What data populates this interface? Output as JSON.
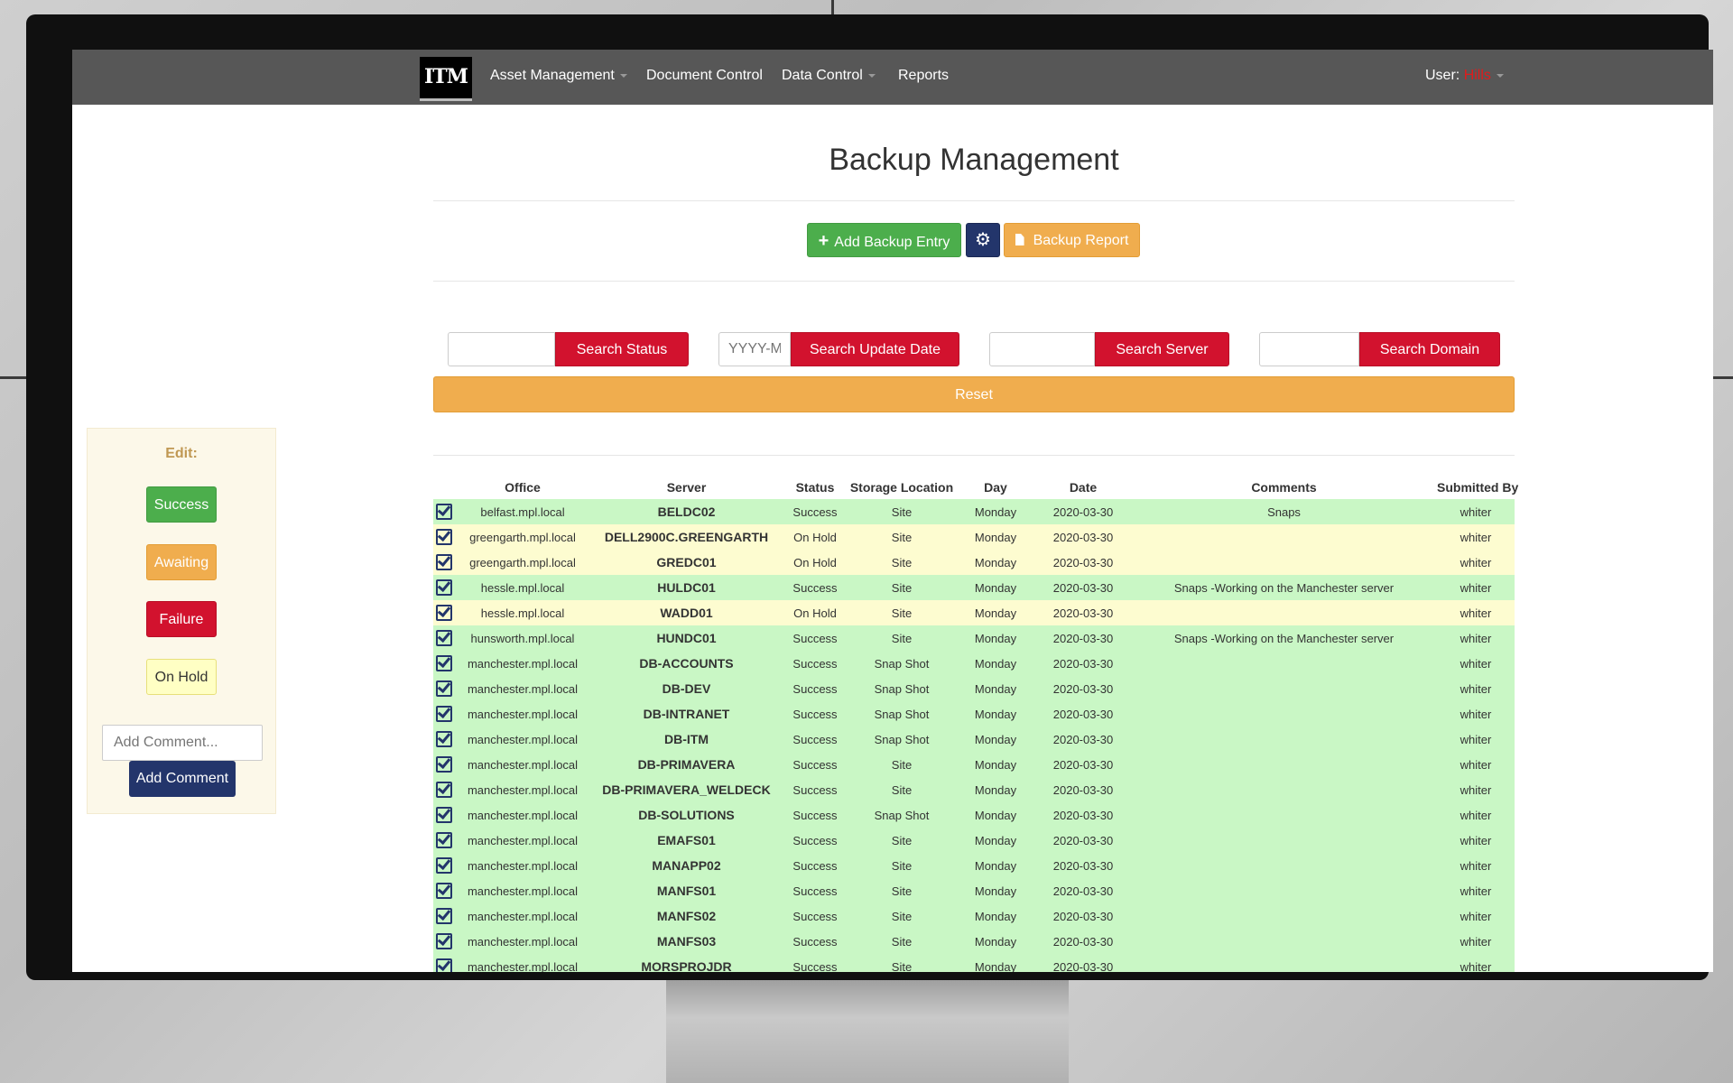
{
  "nav": {
    "brand": "ITM",
    "items": [
      "Asset Management",
      "Document Control",
      "Data Control",
      "Reports"
    ],
    "user_label": "User:",
    "user_name": "Hills"
  },
  "page": {
    "title": "Backup Management",
    "add_button": "Add Backup Entry",
    "report_button": "Backup Report"
  },
  "search": {
    "status_button": "Search Status",
    "date_placeholder": "YYYY-M",
    "date_button": "Search Update Date",
    "server_button": "Search Server",
    "domain_button": "Search Domain",
    "reset_button": "Reset"
  },
  "edit_panel": {
    "title": "Edit:",
    "success": "Success",
    "awaiting": "Awaiting",
    "failure": "Failure",
    "on_hold": "On Hold",
    "comment_placeholder": "Add Comment...",
    "comment_button": "Add Comment"
  },
  "colors": {
    "navbar": "#575757",
    "success_row": "#c9f7c5",
    "hold_row": "#fdfcd0",
    "primary": "#23356b",
    "danger": "#d2122e",
    "warning": "#f0ad4e",
    "success": "#4cae4c"
  },
  "table": {
    "headers": [
      "",
      "Office",
      "Server",
      "Status",
      "Storage Location",
      "Day",
      "Date",
      "Comments",
      "Submitted By"
    ],
    "rows": [
      {
        "office": "belfast.mpl.local",
        "server": "BELDC02",
        "status": "Success",
        "storage": "Site",
        "day": "Monday",
        "date": "2020-03-30",
        "comments": "Snaps",
        "by": "whiter"
      },
      {
        "office": "greengarth.mpl.local",
        "server": "DELL2900C.GREENGARTH",
        "status": "On Hold",
        "storage": "Site",
        "day": "Monday",
        "date": "2020-03-30",
        "comments": "",
        "by": "whiter"
      },
      {
        "office": "greengarth.mpl.local",
        "server": "GREDC01",
        "status": "On Hold",
        "storage": "Site",
        "day": "Monday",
        "date": "2020-03-30",
        "comments": "",
        "by": "whiter"
      },
      {
        "office": "hessle.mpl.local",
        "server": "HULDC01",
        "status": "Success",
        "storage": "Site",
        "day": "Monday",
        "date": "2020-03-30",
        "comments": "Snaps -Working on the Manchester server",
        "by": "whiter"
      },
      {
        "office": "hessle.mpl.local",
        "server": "WADD01",
        "status": "On Hold",
        "storage": "Site",
        "day": "Monday",
        "date": "2020-03-30",
        "comments": "",
        "by": "whiter"
      },
      {
        "office": "hunsworth.mpl.local",
        "server": "HUNDC01",
        "status": "Success",
        "storage": "Site",
        "day": "Monday",
        "date": "2020-03-30",
        "comments": "Snaps -Working on the Manchester server",
        "by": "whiter"
      },
      {
        "office": "manchester.mpl.local",
        "server": "DB-ACCOUNTS",
        "status": "Success",
        "storage": "Snap Shot",
        "day": "Monday",
        "date": "2020-03-30",
        "comments": "",
        "by": "whiter"
      },
      {
        "office": "manchester.mpl.local",
        "server": "DB-DEV",
        "status": "Success",
        "storage": "Snap Shot",
        "day": "Monday",
        "date": "2020-03-30",
        "comments": "",
        "by": "whiter"
      },
      {
        "office": "manchester.mpl.local",
        "server": "DB-INTRANET",
        "status": "Success",
        "storage": "Snap Shot",
        "day": "Monday",
        "date": "2020-03-30",
        "comments": "",
        "by": "whiter"
      },
      {
        "office": "manchester.mpl.local",
        "server": "DB-ITM",
        "status": "Success",
        "storage": "Snap Shot",
        "day": "Monday",
        "date": "2020-03-30",
        "comments": "",
        "by": "whiter"
      },
      {
        "office": "manchester.mpl.local",
        "server": "DB-PRIMAVERA",
        "status": "Success",
        "storage": "Site",
        "day": "Monday",
        "date": "2020-03-30",
        "comments": "",
        "by": "whiter"
      },
      {
        "office": "manchester.mpl.local",
        "server": "DB-PRIMAVERA_WELDECK",
        "status": "Success",
        "storage": "Site",
        "day": "Monday",
        "date": "2020-03-30",
        "comments": "",
        "by": "whiter"
      },
      {
        "office": "manchester.mpl.local",
        "server": "DB-SOLUTIONS",
        "status": "Success",
        "storage": "Snap Shot",
        "day": "Monday",
        "date": "2020-03-30",
        "comments": "",
        "by": "whiter"
      },
      {
        "office": "manchester.mpl.local",
        "server": "EMAFS01",
        "status": "Success",
        "storage": "Site",
        "day": "Monday",
        "date": "2020-03-30",
        "comments": "",
        "by": "whiter"
      },
      {
        "office": "manchester.mpl.local",
        "server": "MANAPP02",
        "status": "Success",
        "storage": "Site",
        "day": "Monday",
        "date": "2020-03-30",
        "comments": "",
        "by": "whiter"
      },
      {
        "office": "manchester.mpl.local",
        "server": "MANFS01",
        "status": "Success",
        "storage": "Site",
        "day": "Monday",
        "date": "2020-03-30",
        "comments": "",
        "by": "whiter"
      },
      {
        "office": "manchester.mpl.local",
        "server": "MANFS02",
        "status": "Success",
        "storage": "Site",
        "day": "Monday",
        "date": "2020-03-30",
        "comments": "",
        "by": "whiter"
      },
      {
        "office": "manchester.mpl.local",
        "server": "MANFS03",
        "status": "Success",
        "storage": "Site",
        "day": "Monday",
        "date": "2020-03-30",
        "comments": "",
        "by": "whiter"
      },
      {
        "office": "manchester.mpl.local",
        "server": "MORSPROJDR",
        "status": "Success",
        "storage": "Site",
        "day": "Monday",
        "date": "2020-03-30",
        "comments": "",
        "by": "whiter"
      }
    ]
  }
}
